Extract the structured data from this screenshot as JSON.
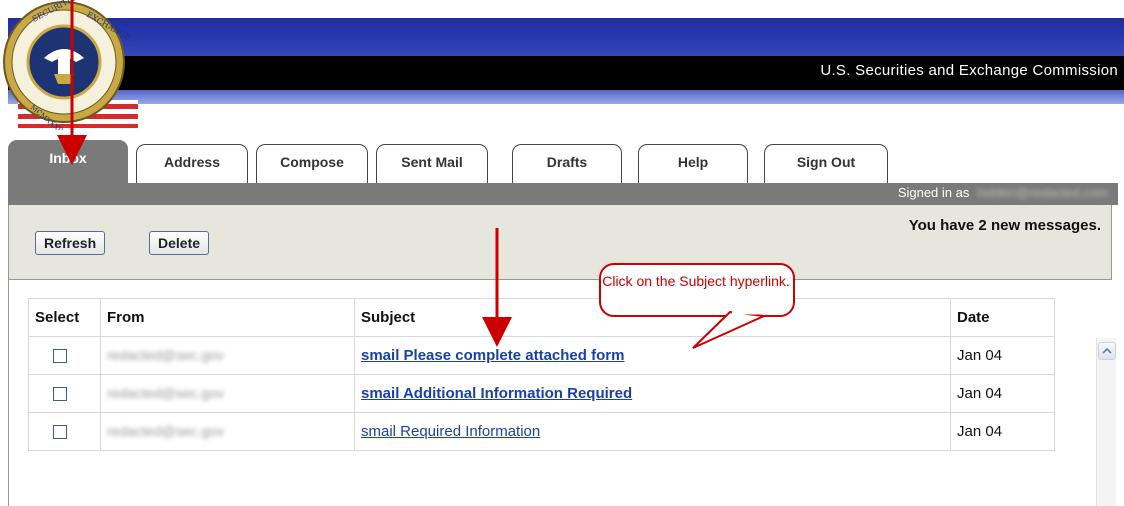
{
  "header": {
    "agency_name": "U.S. Securities and Exchange Commission",
    "seal_icon": "sec-seal-logo"
  },
  "tabs": [
    {
      "label": "Inbox",
      "active": true
    },
    {
      "label": "Address"
    },
    {
      "label": "Compose"
    },
    {
      "label": "Sent Mail"
    },
    {
      "label": "Drafts"
    },
    {
      "label": "Help"
    },
    {
      "label": "Sign Out"
    }
  ],
  "signed_in": {
    "label": "Signed in as",
    "email": "hidden@redacted.com"
  },
  "toolbar": {
    "refresh_label": "Refresh",
    "delete_label": "Delete",
    "new_messages": "You have 2 new messages."
  },
  "table": {
    "headers": [
      "Select",
      "From",
      "Subject",
      "Date"
    ],
    "rows": [
      {
        "from": "redacted@sec.gov",
        "subject": "smail Please complete attached form",
        "date": "Jan 04",
        "unread": true
      },
      {
        "from": "redacted@sec.gov",
        "subject": "smail Additional Information Required",
        "date": "Jan 04",
        "unread": true
      },
      {
        "from": "redacted@sec.gov",
        "subject": "smail Required Information",
        "date": "Jan 04",
        "unread": false
      }
    ]
  },
  "callout": {
    "text": "Click on the Subject hyperlink."
  },
  "colors": {
    "header_blue": "#2a3ab0",
    "tab_active": "#7a7a7a",
    "toolbar_bg": "#e6e6dc",
    "link": "#1a3fa8",
    "annotation_red": "#cc0000"
  }
}
